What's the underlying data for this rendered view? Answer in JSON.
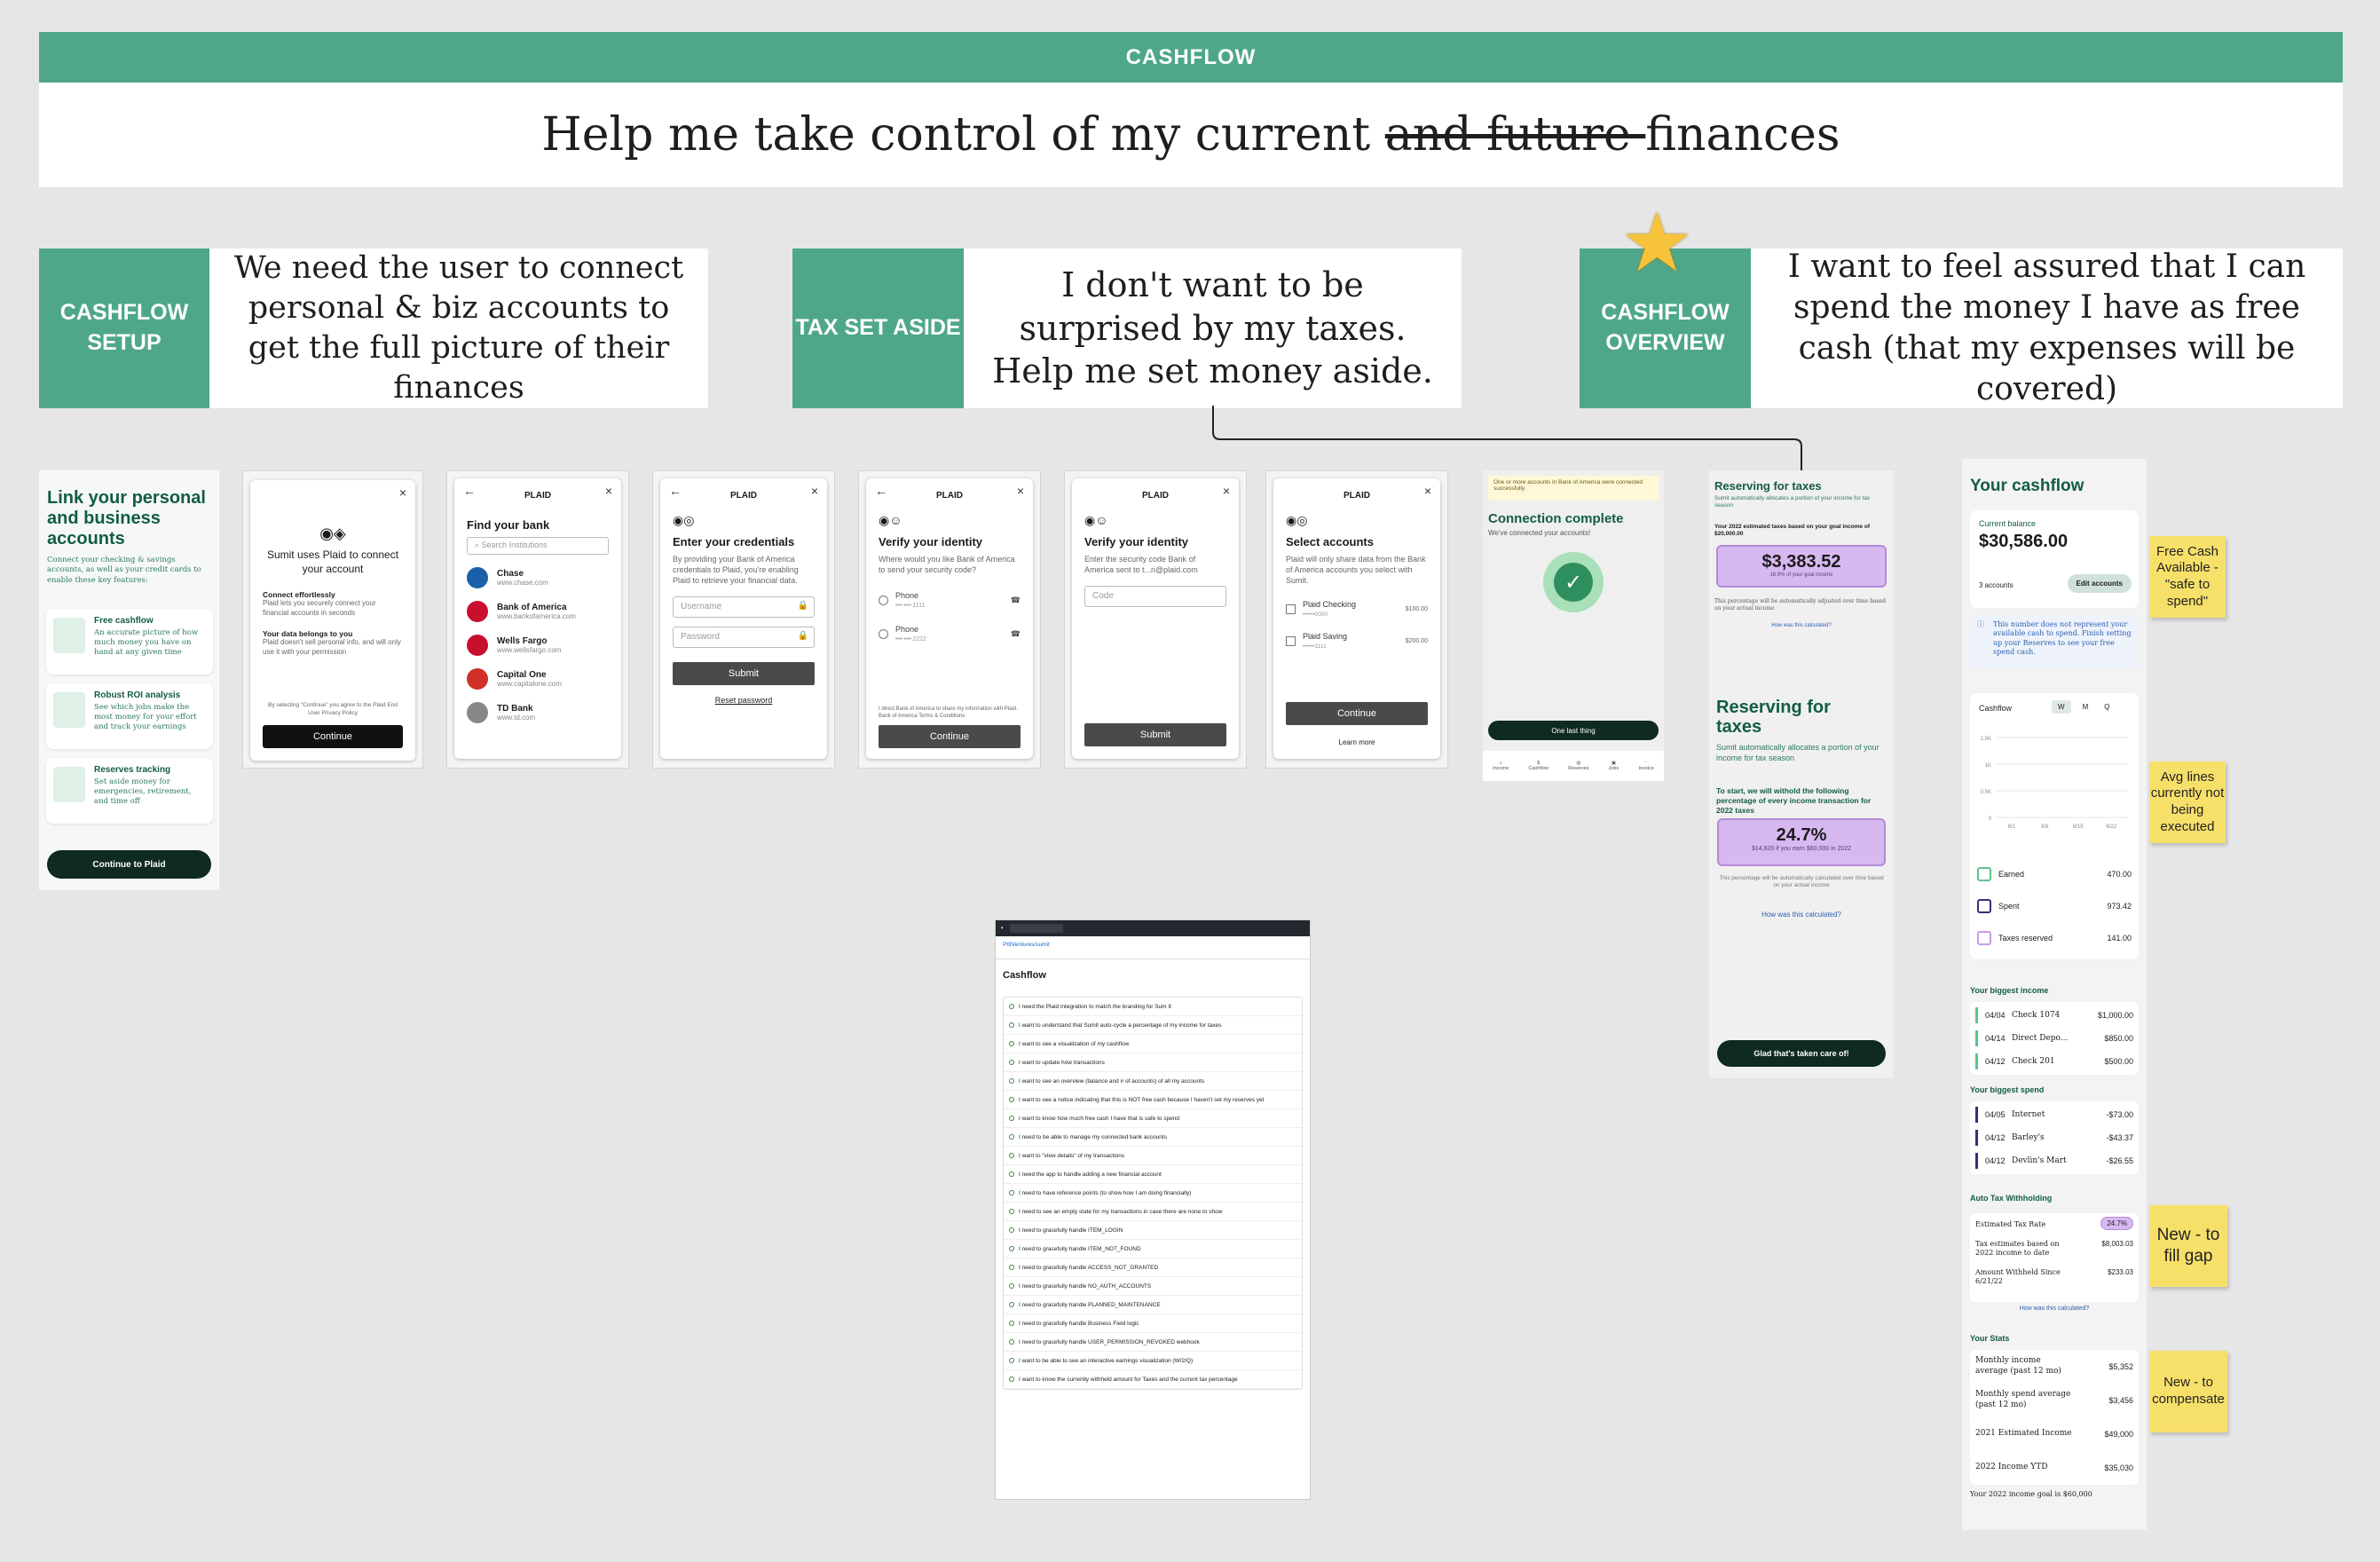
{
  "banner": {
    "title": "CASHFLOW"
  },
  "headline": {
    "pre": "Help me take control of my current ",
    "struck": "and future ",
    "post": "finances"
  },
  "stories": [
    {
      "tag": "CASHFLOW SETUP",
      "text": "We need the user to connect personal & biz accounts to get the full picture of their finances"
    },
    {
      "tag": "TAX SET ASIDE",
      "text": "I don't want to be surprised by my taxes. Help me set money aside."
    },
    {
      "tag": "CASHFLOW OVERVIEW",
      "text": "I want to feel assured that I can spend the money I have as free cash (that my expenses will be covered)"
    }
  ],
  "link_screen": {
    "title": "Link your personal and business accounts",
    "subtitle": "Connect your checking & savings accounts, as well as your credit cards to enable these key features:",
    "features": [
      {
        "title": "Free cashflow",
        "text": "An accurate picture of how much money you have on hand at any given time"
      },
      {
        "title": "Robust ROI analysis",
        "text": "See which jobs make the most money for your effort and track your earnings"
      },
      {
        "title": "Reserves tracking",
        "text": "Set aside money for emergencies, retirement, and time off"
      }
    ],
    "cta": "Continue to Plaid"
  },
  "plaid_intro": {
    "title": "Sumit uses Plaid to connect your account",
    "p1_title": "Connect effortlessly",
    "p1_text": "Plaid lets you securely connect your financial accounts in seconds",
    "p2_title": "Your data belongs to you",
    "p2_text": "Plaid doesn't sell personal info, and will only use it with your permission",
    "legal": "By selecting \"Continue\" you agree to the Plaid End User Privacy Policy",
    "cta": "Continue"
  },
  "find_bank": {
    "logo": "PLAID",
    "title": "Find your bank",
    "placeholder": "Search Institutions",
    "banks": [
      {
        "name": "Chase",
        "url": "www.chase.com",
        "color": "#1a5fa8"
      },
      {
        "name": "Bank of America",
        "url": "www.bankofamerica.com",
        "color": "#c8102e"
      },
      {
        "name": "Wells Fargo",
        "url": "www.wellsfargo.com",
        "color": "#c8102e"
      },
      {
        "name": "Capital One",
        "url": "www.capitalone.com",
        "color": "#d03027"
      },
      {
        "name": "TD Bank",
        "url": "www.td.com",
        "color": "#888888"
      }
    ]
  },
  "credentials": {
    "logo": "PLAID",
    "title": "Enter your credentials",
    "text": "By providing your Bank of America credentials to Plaid, you're enabling Plaid to retrieve your financial data.",
    "username": "Username",
    "password": "Password",
    "cta": "Submit",
    "reset": "Reset password"
  },
  "verify1": {
    "logo": "PLAID",
    "title": "Verify your identity",
    "text": "Where would you like Bank of America to send your security code?",
    "opt1": "Phone",
    "opt1_sub": "•••-•••-1111",
    "opt2": "Phone",
    "opt2_sub": "•••-•••-2222",
    "legal": "I direct Bank of America to share my information with Plaid. Bank of America Terms & Conditions",
    "cta": "Continue"
  },
  "verify2": {
    "logo": "PLAID",
    "title": "Verify your identity",
    "text": "Enter the security code Bank of America sent to t...n@plaid.com",
    "code": "Code",
    "cta": "Submit"
  },
  "select_accounts": {
    "logo": "PLAID",
    "title": "Select accounts",
    "text": "Plaid will only share data from the Bank of America accounts you select with Sumit.",
    "acc1": "Plaid Checking",
    "acc1_sub": "••••••0000",
    "acc1_amt": "$100.00",
    "acc2": "Plaid Saving",
    "acc2_sub": "••••••1111",
    "acc2_amt": "$200.00",
    "cta": "Continue",
    "more": "Learn more"
  },
  "connection": {
    "notice": "One or more accounts in Bank of America were connected successfully.",
    "title": "Connection complete",
    "sub": "We've connected your accounts!",
    "cta": "One last thing",
    "nav": [
      "Income",
      "Cashflow",
      "Reserves",
      "Jobs",
      "Invoice"
    ]
  },
  "tax1": {
    "title": "Reserving for taxes",
    "sub": "Sumit automatically allocates a portion of your income for tax season",
    "goal": "Your 2022 estimated taxes based on your goal income of $20,000.00",
    "amount": "$3,383.52",
    "amount_sub": "16.9% of your goal income",
    "note": "This percentage will be automatically adjusted over time based on your actual income",
    "link": "How was this calculated?"
  },
  "tax2": {
    "title": "Reserving for taxes",
    "sub": "Sumit automatically allocates a portion of your income for tax season",
    "lead": "To start, we will withold the following percentage of every income transaction for 2022 taxes",
    "pct": "24.7%",
    "pct_sub": "$14,820 if you earn $60,000 in 2022",
    "note": "This percentage will be automatically calculated over time based on your actual income",
    "link": "How was this calculated?",
    "cta": "Glad that's taken care of!"
  },
  "github": {
    "repo": "Pt9Ventures/sumit",
    "title": "Cashflow",
    "issues": [
      "I need the Plaid integration to match the branding for Sum It",
      "I want to understand that Sumit auto-cycle a percentage of my income for taxes",
      "I want to see a visualization of my cashflow",
      "I want to update how transactions",
      "I want to see an overview (balance and # of accounts) of all my accounts",
      "I want to see a notice indicating that this is NOT free cash because I haven't set my reserves yet",
      "I want to know how much free cash I have that is safe to spend",
      "I need to be able to manage my connected bank accounts",
      "I want to \"view details\" of my transactions",
      "I need the app to handle adding a new financial account",
      "I need to have reference points (to show how I am doing financially)",
      "I need to see an empty state for my transactions in case there are none to show",
      "I need to gracefully handle ITEM_LOGIN",
      "I need to gracefully handle ITEM_NOT_FOUND",
      "I need to gracefully handle ACCESS_NOT_GRANTED",
      "I need to gracefully handle NO_AUTH_ACCOUNTS",
      "I need to gracefully handle PLANNED_MAINTENANCE",
      "I need to gracefully handle Business Field logic",
      "I need to gracefully handle USER_PERMISSION_REVOKED webhook",
      "I want to be able to see an interactive earnings visualization (W/2/Q)",
      "I want to know the currently withheld amount for Taxes and the current tax percentage"
    ]
  },
  "cashflow": {
    "title": "Your cashflow",
    "balance_label": "Current balance",
    "balance": "$30,586.00",
    "accounts": "3 accounts",
    "edit": "Edit accounts",
    "info": "This number does not represent your available cash to spend. Finish setting up your Reserves to see your free spend cash.",
    "chart_label": "Cashflow",
    "periods": [
      "W",
      "M",
      "Q"
    ],
    "legend": [
      {
        "label": "Earned",
        "value": "470.00",
        "color": "#5cc48c"
      },
      {
        "label": "Spent",
        "value": "973.42",
        "color": "#3b2d7a"
      },
      {
        "label": "Taxes reserved",
        "value": "141.00",
        "color": "#c89be6"
      }
    ],
    "income_title": "Your biggest income",
    "income": [
      {
        "date": "04/04",
        "desc": "Check 1074",
        "amt": "$1,000.00"
      },
      {
        "date": "04/14",
        "desc": "Direct Depo...",
        "amt": "$850.00"
      },
      {
        "date": "04/12",
        "desc": "Check 201",
        "amt": "$500.00"
      }
    ],
    "spend_title": "Your biggest spend",
    "spend": [
      {
        "date": "04/05",
        "desc": "Internet",
        "amt": "-$73.00"
      },
      {
        "date": "04/12",
        "desc": "Barley's",
        "amt": "-$43.37"
      },
      {
        "date": "04/12",
        "desc": "Devlin's Mart",
        "amt": "-$26.55"
      }
    ],
    "tax_title": "Auto Tax Withholding",
    "tax_rate_label": "Estimated Tax Rate",
    "tax_rate": "24.7%",
    "tax_est_label": "Tax estimates based on 2022 income to date",
    "tax_est": "$8,003.03",
    "withheld_label": "Amount Withheld Since 6/21/22",
    "withheld": "$233.03",
    "tax_link": "How was this calculated?",
    "stats_title": "Your Stats",
    "stats": [
      {
        "label": "Monthly income average (past 12 mo)",
        "value": "$5,352"
      },
      {
        "label": "Monthly spend average (past 12 mo)",
        "value": "$3,456"
      },
      {
        "label": "2021 Estimated Income",
        "value": "$49,000"
      },
      {
        "label": "2022 Income YTD",
        "value": "$35,030"
      }
    ],
    "goal": "Your 2022 income goal is $60,000"
  },
  "chart_data": {
    "type": "bar",
    "title": "Cashflow",
    "categories": [
      "8/1",
      "8/8",
      "8/15",
      "8/22"
    ],
    "yticks": [
      "1.5K",
      "1K",
      "0.5K",
      "0"
    ],
    "series": []
  },
  "stickies": [
    {
      "text": "Free Cash Available - \"safe to spend\""
    },
    {
      "text": "Avg lines currently not being executed"
    },
    {
      "text": "New - to fill gap"
    },
    {
      "text": "New - to compensate"
    }
  ],
  "colors": {
    "accent": "#4fa78b",
    "sticky": "#f7e06a",
    "purple": "#d8b8f0",
    "dark_green": "#0f2a20"
  }
}
